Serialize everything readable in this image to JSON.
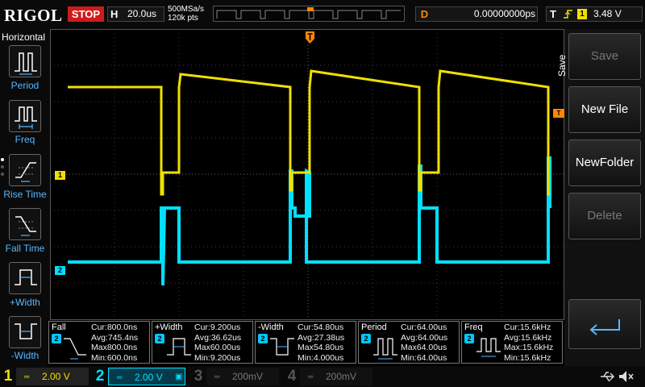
{
  "header": {
    "logo": "RIGOL",
    "run_state": "STOP",
    "h_label": "H",
    "timebase": "20.0us",
    "sample_rate": "500MSa/s",
    "points": "120k pts",
    "delay_label": "D",
    "delay": "0.00000000ps",
    "trig_label": "T",
    "trig_source": "1",
    "trig_level": "3.48 V"
  },
  "left_panel": {
    "title": "Horizontal",
    "items": [
      {
        "label": "Period",
        "icon": "period-icon"
      },
      {
        "label": "Freq",
        "icon": "freq-icon"
      },
      {
        "label": "Rise Time",
        "icon": "rise-time-icon"
      },
      {
        "label": "Fall Time",
        "icon": "fall-time-icon"
      },
      {
        "label": "+Width",
        "icon": "pos-width-icon"
      },
      {
        "label": "-Width",
        "icon": "neg-width-icon"
      }
    ]
  },
  "markers": {
    "ch1": "1",
    "ch2": "2",
    "trig_level": "T"
  },
  "right_panel": {
    "title": "Save",
    "buttons": [
      {
        "label": "Save",
        "enabled": false
      },
      {
        "label": "New File",
        "enabled": true
      },
      {
        "label": "NewFolder",
        "enabled": true
      },
      {
        "label": "Delete",
        "enabled": false
      }
    ],
    "enter_icon": "enter-arrow-icon"
  },
  "measurements": [
    {
      "name": "Fall",
      "channel": "2",
      "cur": "Cur:800.0ns",
      "avg": "Avg:745.4ns",
      "max": "Max800.0ns",
      "min": "Min:600.0ns"
    },
    {
      "name": "+Width",
      "channel": "2",
      "cur": "Cur:9.200us",
      "avg": "Avg:36.62us",
      "max": "Max60.00us",
      "min": "Min:9.200us"
    },
    {
      "name": "-Width",
      "channel": "2",
      "cur": "Cur:54.80us",
      "avg": "Avg:27.38us",
      "max": "Max54.80us",
      "min": "Min:4.000us"
    },
    {
      "name": "Period",
      "channel": "2",
      "cur": "Cur:64.00us",
      "avg": "Avg:64.00us",
      "max": "Max64.00us",
      "min": "Min:64.00us"
    },
    {
      "name": "Freq",
      "channel": "2",
      "cur": "Cur:15.6kHz",
      "avg": "Avg:15.6kHz",
      "max": "Max:15.6kHz",
      "min": "Min:15.6kHz"
    }
  ],
  "channels": [
    {
      "num": "1",
      "scale": "2.00 V",
      "color": "#f0e000",
      "active": true
    },
    {
      "num": "2",
      "scale": "2.00 V",
      "color": "#00e0ff",
      "active": true
    },
    {
      "num": "3",
      "scale": "200mV",
      "color": "#777777",
      "active": false
    },
    {
      "num": "4",
      "scale": "200mV",
      "color": "#777777",
      "active": false
    }
  ],
  "status_icons": [
    "usb-icon",
    "sound-icon"
  ],
  "colors": {
    "ch1": "#f0e000",
    "ch2": "#00e0ff",
    "trigger": "#ff8800",
    "stop": "#cf1a1a",
    "accent": "#57b7ff"
  }
}
